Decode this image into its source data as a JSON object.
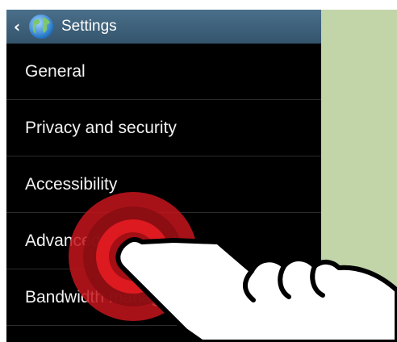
{
  "header": {
    "back_icon": "chevron-left-icon",
    "app_icon": "globe-icon",
    "title": "Settings"
  },
  "menu": {
    "items": [
      {
        "label": "General"
      },
      {
        "label": "Privacy and security"
      },
      {
        "label": "Accessibility"
      },
      {
        "label": "Advanced"
      },
      {
        "label": "Bandwidth management"
      }
    ]
  },
  "overlay": {
    "tap_indicator_icon": "tap-ripple-icon",
    "hand_icon": "pointing-hand-icon"
  },
  "colors": {
    "action_bar": "#34546c",
    "background": "#000000",
    "side_panel": "#c2d5a8",
    "tap_ripple": "#e01b22"
  }
}
